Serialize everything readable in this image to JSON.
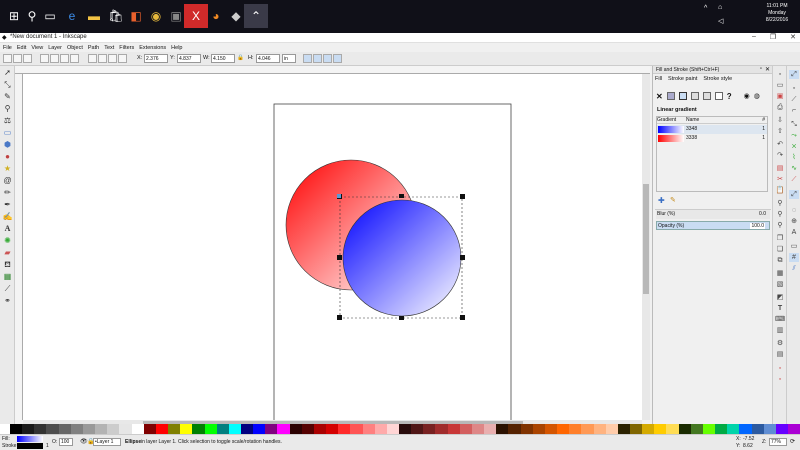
{
  "taskbar": {
    "icons": [
      "windows-start-icon",
      "search-icon",
      "task-view-icon",
      "edge-icon",
      "file-explorer-icon",
      "store-icon",
      "office-icon",
      "chrome-icon",
      "app-icon",
      "xampp-icon",
      "firefox-icon",
      "inkscape-icon",
      "up-arrow-icon"
    ],
    "clock_time": "11:01 PM",
    "clock_day": "Monday",
    "clock_date": "8/22/2016"
  },
  "window": {
    "title": "*New document 1 - Inkscape"
  },
  "menu": [
    "File",
    "Edit",
    "View",
    "Layer",
    "Object",
    "Path",
    "Text",
    "Filters",
    "Extensions",
    "Help"
  ],
  "commands": {
    "x_label": "X:",
    "x_value": "2.376",
    "y_label": "Y:",
    "y_value": "4.837",
    "w_label": "W:",
    "w_value": "4.150",
    "h_label": "H:",
    "h_value": "4.046",
    "unit": "in"
  },
  "dock": {
    "panel_title": "Fill and Stroke (Shift+Ctrl+F)",
    "tabs": [
      "Fill",
      "Stroke paint",
      "Stroke style"
    ],
    "section_label": "Linear gradient",
    "table_headers": [
      "Gradient",
      "Name",
      "#"
    ],
    "gradients": [
      {
        "name": "3348",
        "count": "1",
        "from": "#0000ff",
        "to": "#ffffff"
      },
      {
        "name": "3338",
        "count": "1",
        "from": "#ff0000",
        "to": "#ffffff"
      }
    ],
    "blur_label": "Blur (%)",
    "blur_value": "0.0",
    "opacity_label": "Opacity (%)",
    "opacity_value": "100.0"
  },
  "status": {
    "fill_label": "Fill:",
    "stroke_label": "Stroke:",
    "stroke_width": "1",
    "opacity_label": "O:",
    "opacity_value": "100",
    "layer": "•Layer 1",
    "message_bold": "Ellipse",
    "message": " in layer Layer 1. Click selection to toggle scale/rotation handles.",
    "x_label": "X:",
    "x_value": "-7.52",
    "y_label": "Y:",
    "y_value": "8.62",
    "z_label": "Z:",
    "zoom": "77%"
  },
  "colors": {
    "accent_blue": "#0000ff",
    "accent_red": "#ff0000",
    "selection_highlight": "#c9dcf2"
  }
}
